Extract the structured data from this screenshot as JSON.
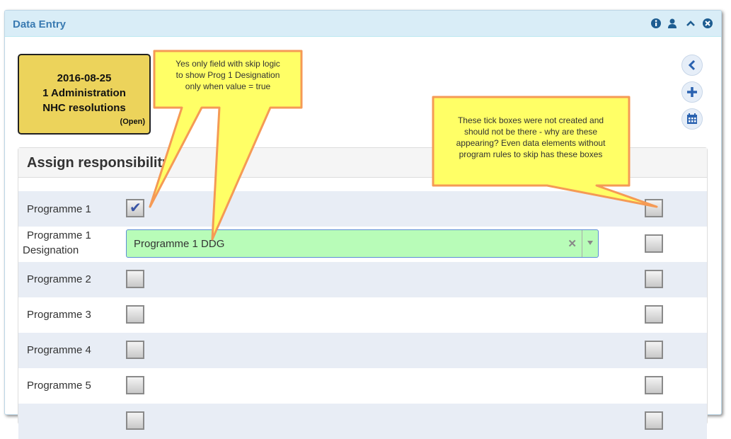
{
  "panel": {
    "title": "Data Entry",
    "icons": [
      "info-icon",
      "user-icon",
      "collapse-icon",
      "close-icon"
    ]
  },
  "event": {
    "date": "2016-08-25",
    "line1": "1 Administration",
    "line2": "NHC resolutions",
    "status": "(Open)"
  },
  "section": {
    "title": "Assign responsibility"
  },
  "rows": [
    {
      "label": "Programme 1",
      "checked": true
    },
    {
      "label": "Programme 1",
      "label2": "Designation",
      "select_value": "Programme 1 DDG"
    },
    {
      "label": "Programme 2",
      "checked": false
    },
    {
      "label": "Programme 3",
      "checked": false
    },
    {
      "label": "Programme 4",
      "checked": false
    },
    {
      "label": "Programme 5",
      "checked": false
    }
  ],
  "side_buttons": [
    "back-icon",
    "add-icon",
    "calendar-icon"
  ],
  "callouts": {
    "left": {
      "line1": "Yes only field with skip logic",
      "line2": "to show Prog 1 Designation",
      "line3": "only when value = true"
    },
    "right": {
      "line1": "These tick boxes were not created and",
      "line2": "should not be there - why are these",
      "line3": "appearing? Even data elements without",
      "line4": "program rules to skip has these boxes"
    }
  },
  "colors": {
    "header_bg": "#d9edf7",
    "title": "#3a7bb2",
    "event_card": "#ecd35b",
    "select_bg": "#b8fcb8",
    "callout_fill": "#ffff66",
    "callout_border": "#f59a55"
  }
}
